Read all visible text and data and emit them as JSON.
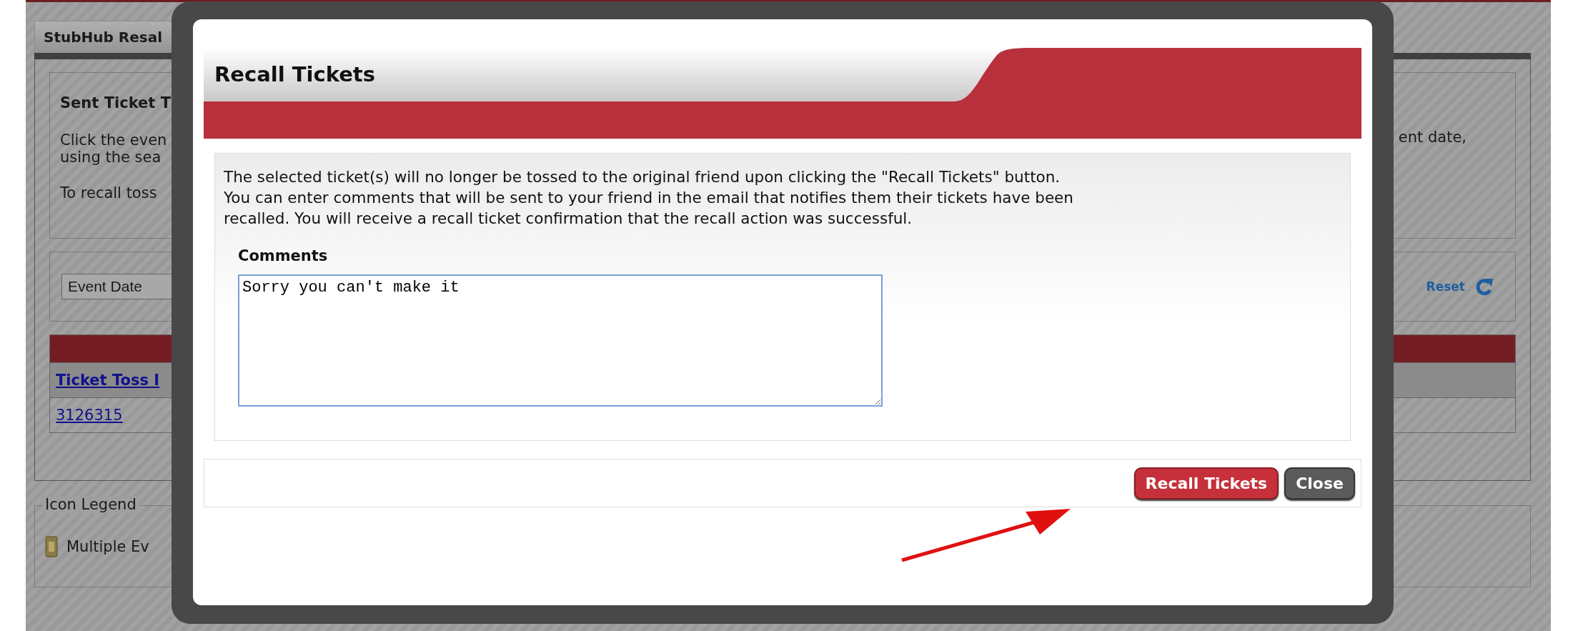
{
  "page": {
    "tab": "StubHub Resal",
    "intro": {
      "title": "Sent Ticket T",
      "lines": [
        "Click the even",
        "using the sea",
        "To recall toss"
      ],
      "right_text": "ent date,"
    },
    "filter": {
      "select_value": "Event Date",
      "reset": "Reset"
    },
    "table": {
      "column_1": "Ticket Toss I",
      "rows": [
        "3126315"
      ]
    },
    "legend": {
      "title": "Icon Legend",
      "items": [
        "Multiple Ev"
      ]
    }
  },
  "dialog": {
    "title": "Recall Tickets",
    "message_lines": [
      "The selected ticket(s) will no longer be tossed to the original friend upon clicking the \"Recall Tickets\" button.",
      "You can enter comments that will be sent to your friend in the email that notifies them their tickets have been",
      "recalled. You will receive a recall ticket confirmation that the recall action was successful."
    ],
    "comments_label": "Comments",
    "comments_value": "Sorry you can't make it",
    "buttons": [
      {
        "label": "Recall Tickets",
        "kind": "primary"
      },
      {
        "label": "Close",
        "kind": "secondary"
      }
    ]
  }
}
